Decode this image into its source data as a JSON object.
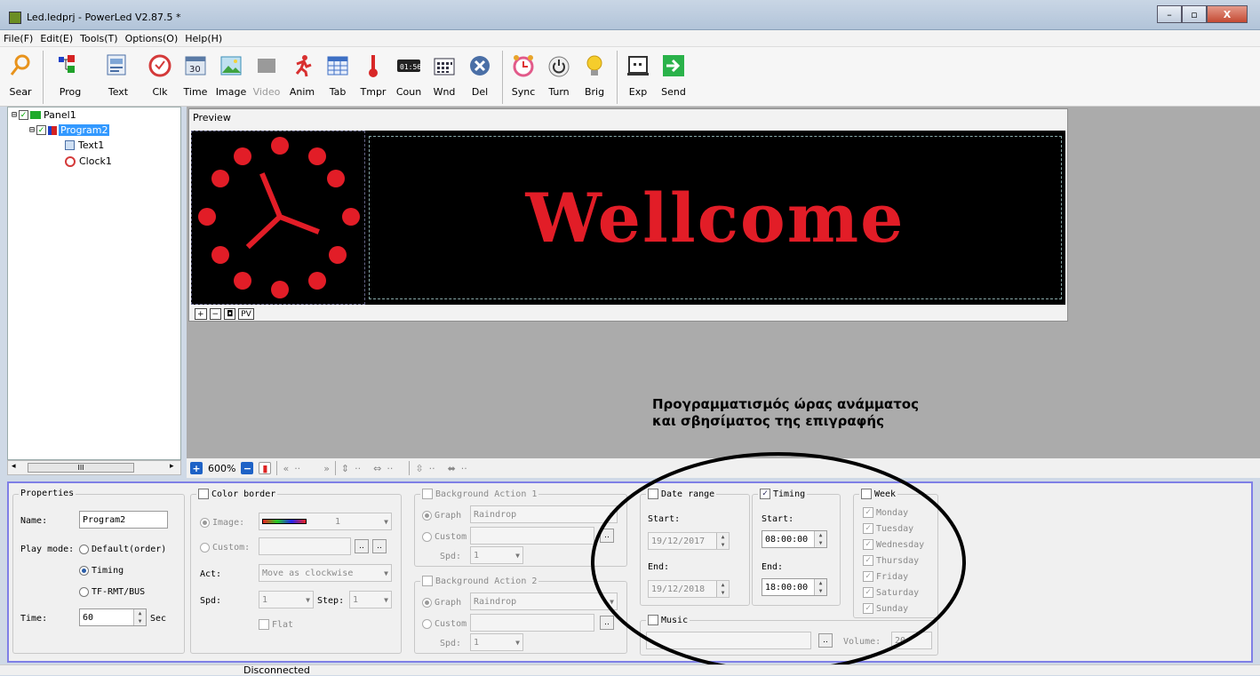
{
  "window": {
    "title": "Led.ledprj - PowerLed V2.87.5 *",
    "minimize": "–",
    "maximize": "▫",
    "close": "X"
  },
  "menu": [
    "File(F)",
    "Edit(E)",
    "Tools(T)",
    "Options(O)",
    "Help(H)"
  ],
  "toolbar": {
    "search": "Sear",
    "program": "Prog",
    "text": "Text",
    "clock": "Clk",
    "time": "Time",
    "time_day": "30",
    "image": "Image",
    "video": "Video",
    "anim": "Anim",
    "table": "Tab",
    "temperature": "Tmpr",
    "counter": "Coun",
    "counter_digits": "01:56",
    "window": "Wnd",
    "delete": "Del",
    "sync": "Sync",
    "turn": "Turn",
    "brightness": "Brig",
    "export": "Exp",
    "send": "Send"
  },
  "tree": {
    "panel": "Panel1",
    "program": "Program2",
    "text": "Text1",
    "clock": "Clock1",
    "scroll_thumb": "III"
  },
  "preview": {
    "title": "Preview",
    "display_text": "Wellcome",
    "tools": [
      "+",
      "−",
      "◘",
      "PV"
    ]
  },
  "annotation": {
    "line1": "Προγραμματισμός ώρας ανάμματος",
    "line2": "και σβησίματος της επιγραφής"
  },
  "zoombar": {
    "zoom": "600%",
    "dots": "··"
  },
  "properties": {
    "title": "Properties",
    "name_label": "Name:",
    "name_value": "Program2",
    "play_mode_label": "Play mode:",
    "mode_default": "Default(order)",
    "mode_timing": "Timing",
    "mode_tf": "TF-RMT/BUS",
    "time_label": "Time:",
    "time_value": "60",
    "time_unit": "Sec"
  },
  "color_border": {
    "title": "Color border",
    "image_label": "Image:",
    "image_value": "1",
    "custom_label": "Custom:",
    "browse": "..",
    "act_label": "Act:",
    "act_value": "Move as clockwise",
    "spd_label": "Spd:",
    "spd_value": "1",
    "step_label": "Step:",
    "step_value": "1",
    "flat_label": "Flat"
  },
  "bg_action_1": {
    "title": "Background Action 1",
    "graph_label": "Graph",
    "graph_value": "Raindrop",
    "custom_label": "Custom",
    "browse": "..",
    "spd_label": "Spd:",
    "spd_value": "1"
  },
  "bg_action_2": {
    "title": "Background Action 2",
    "graph_label": "Graph",
    "graph_value": "Raindrop",
    "custom_label": "Custom",
    "browse": "..",
    "spd_label": "Spd:",
    "spd_value": "1"
  },
  "date_range": {
    "title": "Date range",
    "start_label": "Start:",
    "start_value": "19/12/2017",
    "end_label": "End:",
    "end_value": "19/12/2018"
  },
  "timing": {
    "title": "Timing",
    "checked": true,
    "start_label": "Start:",
    "start_value": "08:00:00",
    "end_label": "End:",
    "end_value": "18:00:00"
  },
  "week": {
    "title": "Week",
    "days": [
      "Monday",
      "Tuesday",
      "Wednesday",
      "Thursday",
      "Friday",
      "Saturday",
      "Sunday"
    ]
  },
  "music": {
    "title": "Music",
    "browse": "..",
    "volume_label": "Volume:",
    "volume_value": "20"
  },
  "status": {
    "connection": "Disconnected"
  }
}
